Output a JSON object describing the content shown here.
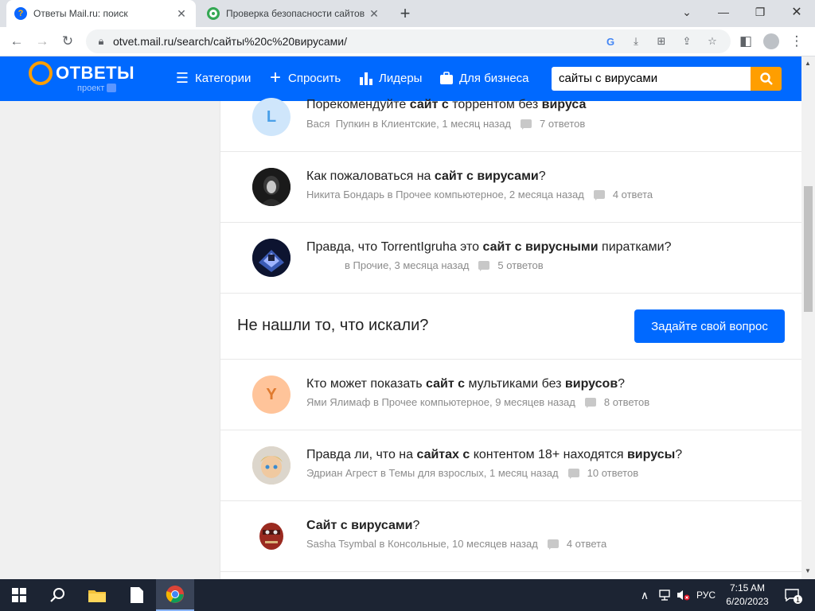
{
  "browser": {
    "tabs": [
      {
        "title": "Ответы Mail.ru: поиск",
        "favicon_color": "#0a66ff"
      },
      {
        "title": "Проверка безопасности сайтов",
        "favicon_color": "#34a853"
      }
    ],
    "new_tab": "+",
    "url": "otvet.mail.ru/search/сайты%20с%20вирусами/"
  },
  "site": {
    "logo": "ОТВЕТЫ",
    "logo_sub": "проект",
    "nav": {
      "categories": "Категории",
      "ask": "Спросить",
      "leaders": "Лидеры",
      "business": "Для бизнеса"
    },
    "search_value": "сайты с вирусами"
  },
  "questions": [
    {
      "title_parts": [
        [
          "Порекомендуйте ",
          false
        ],
        [
          "сайт с",
          true
        ],
        [
          " торрентом без ",
          false
        ],
        [
          "вируса",
          true
        ]
      ],
      "author": "Вася",
      "meta": "Пупкин в Клиентские, 1 месяц назад",
      "answers": "7 ответов",
      "avatar_letter": "L",
      "avatar_color": "#cfe6fb",
      "avatar_text_color": "#4aa0e8"
    },
    {
      "title_parts": [
        [
          "Как пожаловаться на ",
          false
        ],
        [
          "сайт с вирусами",
          true
        ],
        [
          "?",
          false
        ]
      ],
      "author": "Никита Бондарь",
      "meta": "в Прочее компьютерное, 2 месяца назад",
      "answers": "4 ответа",
      "avatar_letter": "",
      "avatar_color": "#1a1a1a",
      "avatar_text_color": "#ffffff"
    },
    {
      "title_parts": [
        [
          "Правда, что TorrentIgruha это ",
          false
        ],
        [
          "сайт с вирусными",
          true
        ],
        [
          " пиратками?",
          false
        ]
      ],
      "author": "",
      "meta": "в Прочие, 3 месяца назад",
      "answers": "5 ответов",
      "avatar_letter": "",
      "avatar_color": "#1f2a55",
      "avatar_text_color": "#ffffff"
    }
  ],
  "not_found": {
    "text": "Не нашли то, что искали?",
    "button": "Задайте свой вопрос"
  },
  "questions2": [
    {
      "title_parts": [
        [
          "Кто может показать ",
          false
        ],
        [
          "сайт с",
          true
        ],
        [
          " мультиками без ",
          false
        ],
        [
          "вирусов",
          true
        ],
        [
          "?",
          false
        ]
      ],
      "author": "Ями Ялимаф",
      "meta": "в Прочее компьютерное, 9 месяцев назад",
      "answers": "8 ответов",
      "avatar_letter": "Y",
      "avatar_color": "#ffc49a",
      "avatar_text_color": "#e07a2e"
    },
    {
      "title_parts": [
        [
          "Правда ли, что на ",
          false
        ],
        [
          "сайтах с",
          true
        ],
        [
          " контентом 18+ находятся ",
          false
        ],
        [
          "вирусы",
          true
        ],
        [
          "?",
          false
        ]
      ],
      "author": "Эдриан Агрест",
      "meta": "в Темы для взрослых, 1 месяц назад",
      "answers": "10 ответов",
      "avatar_letter": "",
      "avatar_color": "#e8c9a0",
      "avatar_text_color": "#ffffff"
    },
    {
      "title_parts": [
        [
          "Сайт с вирусами",
          true
        ],
        [
          "?",
          false
        ]
      ],
      "author": "Sasha Tsymbal",
      "meta": "в Консольные, 10 месяцев назад",
      "answers": "4 ответа",
      "avatar_letter": "",
      "avatar_color": "#ffffff",
      "avatar_text_color": "#ffffff"
    }
  ],
  "taskbar": {
    "language": "РУС",
    "time": "7:15 AM",
    "date": "6/20/2023",
    "notifications": "1"
  },
  "colors": {
    "brand_blue": "#0069ff",
    "brand_orange": "#ff9e00"
  }
}
